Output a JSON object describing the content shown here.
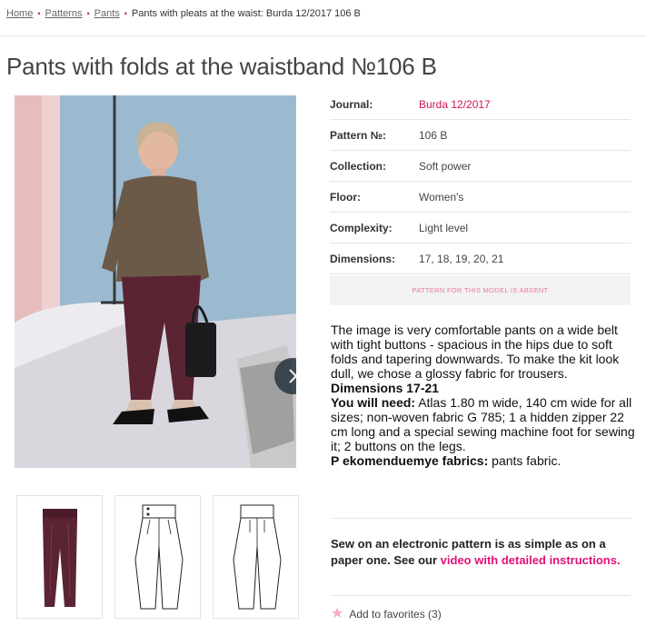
{
  "breadcrumb": {
    "home": "Home",
    "patterns": "Patterns",
    "pants": "Pants",
    "current": "Pants with pleats at the waist: Burda 12/2017 106 B"
  },
  "title": "Pants with folds at the waistband №106 B",
  "details": [
    {
      "label": "Journal:",
      "value": "Burda 12/2017"
    },
    {
      "label": "Pattern №:",
      "value": "106 B"
    },
    {
      "label": "Collection:",
      "value": "Soft power"
    },
    {
      "label": "Floor:",
      "value": "Women's"
    },
    {
      "label": "Complexity:",
      "value": "Light level"
    },
    {
      "label": "Dimensions:",
      "value": "17, 18, 19, 20, 21"
    }
  ],
  "absent_notice": "PATTERN FOR THIS MODEL IS ABSENT",
  "description": {
    "intro": "The image is very comfortable pants on a wide belt with tight buttons - spacious in the hips due to soft folds and tapering downwards. To make the kit look dull, we chose a glossy fabric for trousers.",
    "dimensions_heading": "Dimensions 17-21",
    "need_label": "You will need:",
    "need_text": " Atlas 1.80 m wide, 140 cm wide for all sizes; non-woven fabric G 785; 1 a hidden zipper 22 cm long and a special sewing machine foot for sewing it; 2 buttons on the legs.",
    "fabrics_label": "P ekomenduemye fabrics:",
    "fabrics_text": " pants fabric."
  },
  "sew": {
    "text": "Sew on an electronic pattern is as simple as on a paper one. See our ",
    "link": "video with detailed instructions."
  },
  "favorites": "Add to favorites (3)",
  "colors": {
    "accent": "#d0145a",
    "link_pink": "#e0127a",
    "photo_bg": "#9bb9cf",
    "pants": "#5a2433"
  },
  "icons": {
    "next": "chevron-right-icon",
    "favorite": "star-icon"
  }
}
